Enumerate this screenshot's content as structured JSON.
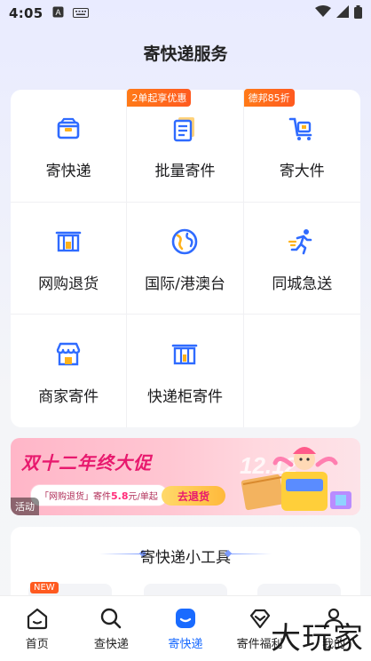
{
  "status_bar": {
    "time": "4:05",
    "icon_a": "A"
  },
  "page": {
    "title": "寄快递服务"
  },
  "services": [
    {
      "label": "寄快递",
      "icon": "box-icon"
    },
    {
      "label": "批量寄件",
      "icon": "documents-icon",
      "badge": "2单起享优惠"
    },
    {
      "label": "寄大件",
      "icon": "cart-icon",
      "badge": "德邦85折"
    },
    {
      "label": "网购退货",
      "icon": "return-shelf-icon"
    },
    {
      "label": "国际/港澳台",
      "icon": "globe-icon"
    },
    {
      "label": "同城急送",
      "icon": "runner-icon"
    },
    {
      "label": "商家寄件",
      "icon": "shop-icon"
    },
    {
      "label": "快递柜寄件",
      "icon": "locker-icon"
    }
  ],
  "banner": {
    "title": "双十二年终大促",
    "subtitle_prefix": "「网购退货」寄件",
    "subtitle_price": "5.8",
    "subtitle_suffix": "元/单起",
    "button": "去退货",
    "tag": "活动"
  },
  "tools": {
    "title": "寄快递小工具",
    "new_badge": "NEW"
  },
  "tabbar": [
    {
      "label": "首页",
      "icon": "home-icon",
      "active": false
    },
    {
      "label": "查快递",
      "icon": "search-icon",
      "active": false
    },
    {
      "label": "寄快递",
      "icon": "send-package-icon",
      "active": true
    },
    {
      "label": "寄件福利",
      "icon": "benefits-icon",
      "active": false
    },
    {
      "label": "我的",
      "icon": "profile-icon",
      "active": false
    }
  ],
  "watermark": "大玩家",
  "colors": {
    "accent": "#1a6bff",
    "badge": "#ff5a1f",
    "banner_pink": "#e8196e"
  }
}
